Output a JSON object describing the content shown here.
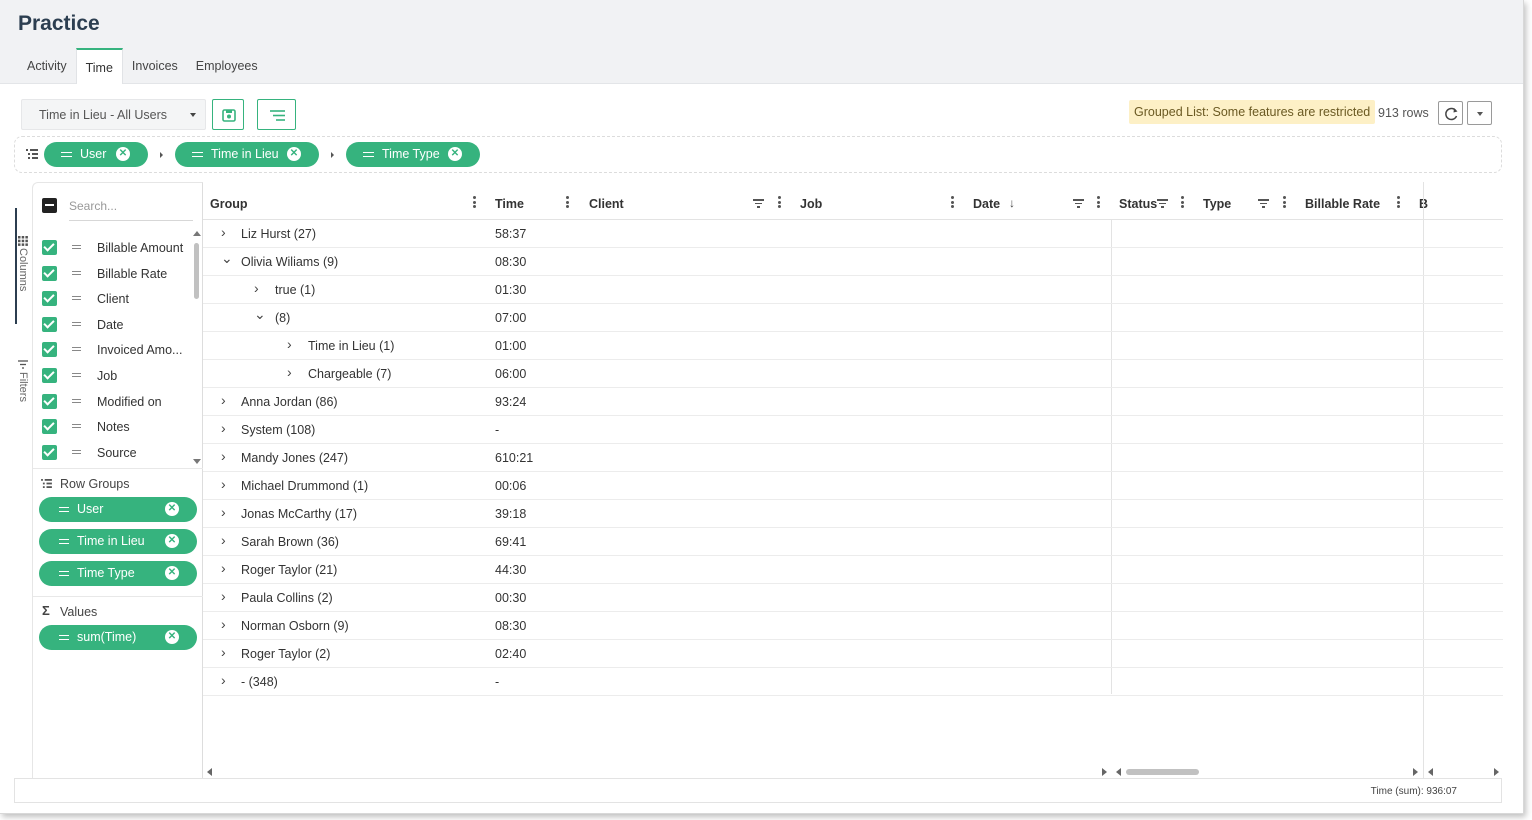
{
  "app": {
    "title": "Practice"
  },
  "tabs": [
    {
      "label": "Activity"
    },
    {
      "label": "Time"
    },
    {
      "label": "Invoices"
    },
    {
      "label": "Employees"
    }
  ],
  "toolbar": {
    "view": "Time in Lieu - All Users",
    "notice": "Grouped List: Some features are restricted",
    "row_count": "913 rows"
  },
  "group_bar": {
    "chips": [
      "User",
      "Time in Lieu",
      "Time Type"
    ]
  },
  "side_tabs": {
    "columns": "Columns",
    "filters": "Filters"
  },
  "column_panel": {
    "search_placeholder": "Search...",
    "columns": [
      "Billable Amount",
      "Billable Rate",
      "Client",
      "Date",
      "Invoiced Amo...",
      "Job",
      "Modified on",
      "Notes",
      "Source"
    ],
    "row_groups_title": "Row Groups",
    "row_groups": [
      "User",
      "Time in Lieu",
      "Time Type"
    ],
    "values_title": "Values",
    "values": [
      "sum(Time)"
    ]
  },
  "grid": {
    "headers": [
      "Group",
      "Time",
      "Client",
      "Job",
      "Date",
      "Status",
      "Type",
      "Billable Rate",
      "B"
    ],
    "rows": [
      {
        "label": "Liz Hurst (27)",
        "time": "58:37",
        "level": 0,
        "expanded": false
      },
      {
        "label": "Olivia Wiliams (9)",
        "time": "08:30",
        "level": 0,
        "expanded": true
      },
      {
        "label": "true (1)",
        "time": "01:30",
        "level": 1,
        "expanded": false
      },
      {
        "label": "(8)",
        "time": "07:00",
        "level": 1,
        "expanded": true
      },
      {
        "label": "Time in Lieu (1)",
        "time": "01:00",
        "level": 2,
        "expanded": false
      },
      {
        "label": "Chargeable (7)",
        "time": "06:00",
        "level": 2,
        "expanded": false
      },
      {
        "label": "Anna Jordan (86)",
        "time": "93:24",
        "level": 0,
        "expanded": false
      },
      {
        "label": "System (108)",
        "time": "-",
        "level": 0,
        "expanded": false
      },
      {
        "label": "Mandy Jones (247)",
        "time": "610:21",
        "level": 0,
        "expanded": false
      },
      {
        "label": "Michael Drummond (1)",
        "time": "00:06",
        "level": 0,
        "expanded": false
      },
      {
        "label": "Jonas McCarthy (17)",
        "time": "39:18",
        "level": 0,
        "expanded": false
      },
      {
        "label": "Sarah Brown (36)",
        "time": "69:41",
        "level": 0,
        "expanded": false
      },
      {
        "label": "Roger Taylor (21)",
        "time": "44:30",
        "level": 0,
        "expanded": false
      },
      {
        "label": "Paula Collins (2)",
        "time": "00:30",
        "level": 0,
        "expanded": false
      },
      {
        "label": "Norman Osborn (9)",
        "time": "08:30",
        "level": 0,
        "expanded": false
      },
      {
        "label": "Roger Taylor (2)",
        "time": "02:40",
        "level": 0,
        "expanded": false
      },
      {
        "label": "- (348)",
        "time": "-",
        "level": 0,
        "expanded": false
      }
    ]
  },
  "status": {
    "total": "Time (sum): 936:07"
  },
  "colors": {
    "accent": "#36b37e",
    "notice_bg": "#fdf0c6"
  }
}
